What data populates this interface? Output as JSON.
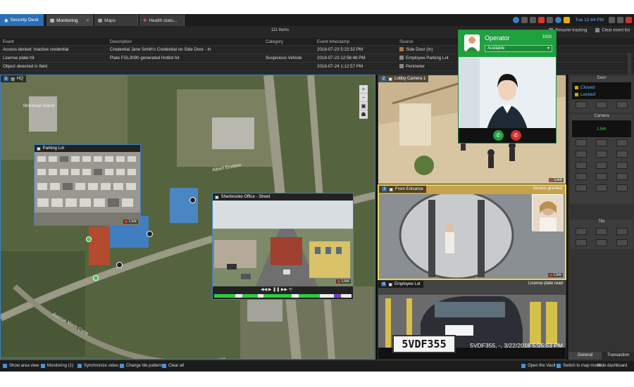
{
  "tabs": {
    "home": "Security Desk",
    "items": [
      {
        "label": "Monitoring"
      },
      {
        "label": "Maps"
      },
      {
        "label": "Health statu..."
      }
    ],
    "time": "Tue 12:44 PM"
  },
  "events": {
    "count": "111 items",
    "resume": "Resume tracking",
    "clear": "Clear event list",
    "headers": [
      "Event",
      "Description",
      "Category",
      "Event timestamp",
      "Source"
    ],
    "rows": [
      [
        "Access denied: Inactive credential",
        "Credential Jane Smith's Credential on Side Door - In",
        "",
        "2018-07-23 5:23:32 PM",
        "Side Door (In)"
      ],
      [
        "License plate hit",
        "Plate FGL3090 generated Hotlist hit",
        "Suspicious Vehicle",
        "2018-07-23 12:56:48 PM",
        "Employee Parking Lot"
      ],
      [
        "Object detected in field",
        "",
        "",
        "2018-07-24 1:12:57 PM",
        "Perimeter"
      ]
    ]
  },
  "map": {
    "tile_num": "1",
    "tile_label": "HQ",
    "labels": [
      "Montreal Island",
      "Albert Einstein",
      "Avenue Marie Curie"
    ],
    "popups": [
      {
        "title": "Parking Lot",
        "live": "Live"
      },
      {
        "title": "Sherbrooke Office - Street",
        "live": "Live"
      }
    ]
  },
  "cameras": [
    {
      "num": "2",
      "title": "Lobby Camera 1",
      "live": "Live"
    },
    {
      "num": "3",
      "title": "Front Entrance",
      "badge": "Access granted",
      "live": "Live"
    },
    {
      "num": "4",
      "title": "Employee Lot",
      "badge": "License plate read",
      "plate": "5VDF355",
      "plate_read": "5VDF355, -, 3/22/2018 5:05:53 PM",
      "live": "Live"
    }
  ],
  "call": {
    "name": "Operator",
    "ext": "1003",
    "status": "Available"
  },
  "dashboard": {
    "door_title": "Door",
    "door_items": [
      "Closed",
      "Locked"
    ],
    "camera_title": "Camera",
    "camera_state": "Live",
    "tile_title": "Tile",
    "tabs": [
      "General",
      "Transaction"
    ]
  },
  "bottombar": {
    "left": [
      "Show area view",
      "Monitoring (1)",
      "Synchronize video",
      "Change tile pattern",
      "Clear all"
    ],
    "right": [
      "Open the Vault",
      "Switch to map mode",
      "Hide dashboard"
    ]
  },
  "colors": {
    "accent": "#2a6fb6",
    "call_green": "#21a040",
    "selected_tile": "#f0d54a"
  }
}
